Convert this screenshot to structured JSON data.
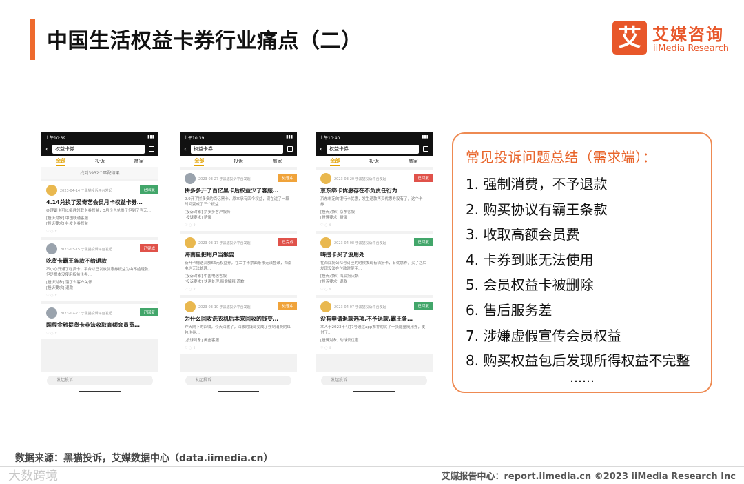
{
  "header": {
    "title": "中国生活权益卡券行业痛点（二）",
    "logo_mark": "艾",
    "logo_cn": "艾媒咨询",
    "logo_en": "iiMedia Research"
  },
  "phones": [
    {
      "time": "上午10:39",
      "search": "权益卡券",
      "tabs": [
        "全部",
        "投诉",
        "商家"
      ],
      "found": "找到3932个匹配结果",
      "input": "发起投诉",
      "cards": [
        {
          "meta": "2023-04-14 于黑猫投诉平台发起",
          "badge": "已回复",
          "badge_color": "green",
          "avatar": "yellow",
          "title": "4.14兑换了爱奇艺会员月卡权益卡券…",
          "body": "办理副卡可以每月领取卡券权益，3月份也兑换了但到了当天…",
          "tags": "[投诉对象] 中国联通客服\n[投诉要求] 补发卡券权益"
        },
        {
          "meta": "2023-03-15 于黑猫投诉平台发起",
          "badge": "已完成",
          "badge_color": "red",
          "avatar": "gray",
          "title": "吃货卡霸王条款不给退款",
          "body": "不小心开通了吃货卡，平台以已发放优惠券权益为由不给退款，但是根本没使用权益卡券…",
          "tags": "[投诉对象] 饿了么客户关怀\n[投诉要求] 退款"
        },
        {
          "meta": "2023-02-27 于黑猫投诉平台发起",
          "badge": "已回复",
          "badge_color": "green",
          "avatar": "gray",
          "title": "网程金融提货卡非法收取高额会员费…",
          "body": "",
          "tags": ""
        }
      ]
    },
    {
      "time": "上午10:39",
      "search": "权益卡券",
      "tabs": [
        "全部",
        "投诉",
        "商家"
      ],
      "found": "",
      "input": "发起投诉",
      "cards": [
        {
          "meta": "2023-03-27 于黑猫投诉平台发起",
          "badge": "处理中",
          "badge_color": "orange",
          "avatar": "gray",
          "title": "拼多多开了百亿黑卡后权益少了客服…",
          "body": "9.9开了拼多多的百亿黑卡，原本承有四个权益，现在过了一段时间变成了三个权益…",
          "tags": "[投诉对象] 拼多多客户服务\n[投诉要求] 赔偿"
        },
        {
          "meta": "2023-03-17 于黑猫投诉平台发起",
          "badge": "已完成",
          "badge_color": "red",
          "avatar": "yellow",
          "title": "海南星把用户当猴耍",
          "body": "新开卡赠送高额66元权益券，在二手卡票面条限无法登录，海南电信无法处理…",
          "tags": "[投诉对象] 中国电信客服\n[投诉要求] 快速处理,赔偿解释,道歉"
        },
        {
          "meta": "2023-03-10 于黑猫投诉平台发起",
          "badge": "处理中",
          "badge_color": "orange",
          "avatar": "yellow",
          "title": "为什么回收洗衣机后本来回收的钱变…",
          "body": "昨天刚下的回收，今天回收了，回收的钱却变成了强制消费的红包卡券…",
          "tags": "[投诉对象] 闲鱼客服"
        }
      ]
    },
    {
      "time": "上午10:40",
      "search": "权益卡券",
      "tabs": [
        "全部",
        "投诉",
        "商家"
      ],
      "found": "",
      "input": "发起投诉",
      "cards": [
        {
          "meta": "2023-03-20 于黑猫投诉平台发起",
          "badge": "已回复",
          "badge_color": "red",
          "avatar": "yellow",
          "title": "京东绑卡优惠存在不负责任行为",
          "body": "京东绑定的银行卡优惠，发生退款再买优惠券没有了，这个卡券…",
          "tags": "[投诉对象] 京东客服\n[投诉要求] 赔偿"
        },
        {
          "meta": "2023-04-08 于黑猫投诉平台发起",
          "badge": "已回复",
          "badge_color": "green",
          "avatar": "yellow",
          "title": "嗨捞卡买了没用处",
          "body": "在海底捞公众号订座的时候发现有嗨捞卡，有优惠券，买了之后发现没法在付款时使用…",
          "tags": "[投诉对象] 海底捞火锅\n[投诉要求] 退款"
        },
        {
          "meta": "2023-04-07 于黑猫投诉平台发起",
          "badge": "已回复",
          "badge_color": "green",
          "avatar": "yellow",
          "title": "没有申请退款选项,不予退款,霸王条…",
          "body": "本人于2023年4月7号通过app推荐购买了一张能量随用券，支付了…",
          "tags": "[投诉对象] 动球云优惠"
        }
      ]
    }
  ],
  "summary": {
    "heading": "常见投诉问题总结（需求端）：",
    "items": [
      "1. 强制消费，不予退款",
      "2. 购买协议有霸王条款",
      "3. 收取高额会员费",
      "4. 卡券到账无法使用",
      "5. 会员权益卡被删除",
      "6. 售后服务差",
      "7. 涉嫌虚假宣传会员权益",
      "8. 购买权益包后发现所得权益不完整"
    ],
    "ellipsis": "……"
  },
  "footer": {
    "source": "数据来源：黑猫投诉，艾媒数据中心（data.iimedia.cn）",
    "watermark": "大数跨境",
    "right": "艾媒报告中心：report.iimedia.cn    ©2023  iiMedia Research  Inc"
  }
}
